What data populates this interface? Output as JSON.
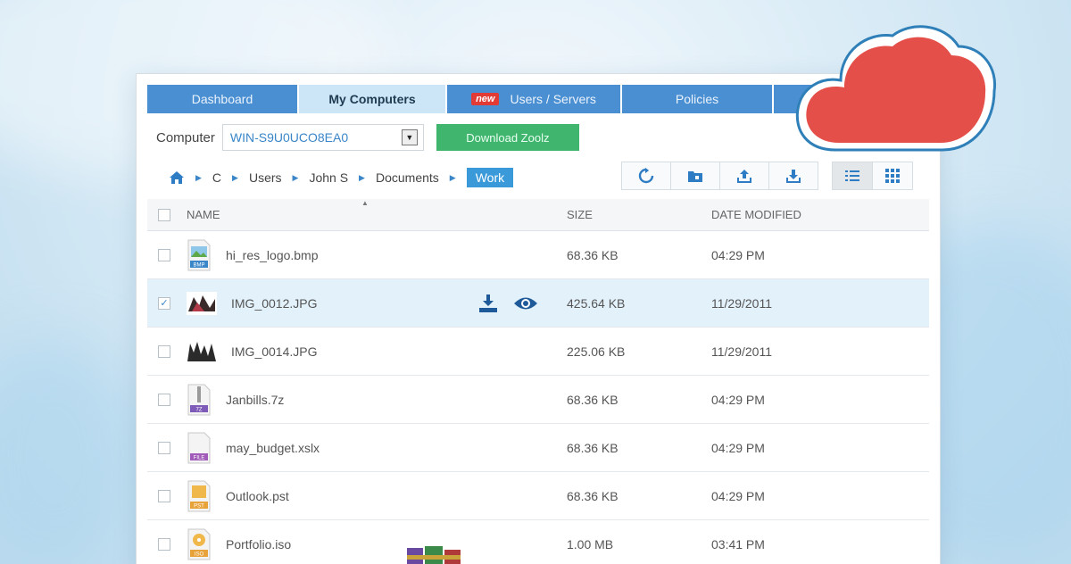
{
  "tabs": [
    {
      "label": "Dashboard",
      "active": false,
      "badge": ""
    },
    {
      "label": "My Computers",
      "active": true,
      "badge": ""
    },
    {
      "label": "Users / Servers",
      "active": false,
      "badge": "new"
    },
    {
      "label": "Policies",
      "active": false,
      "badge": ""
    },
    {
      "label": "",
      "active": false,
      "badge": ""
    }
  ],
  "computer": {
    "label": "Computer",
    "selected": "WIN-S9U0UCO8EA0",
    "download_label": "Download Zoolz"
  },
  "breadcrumb": [
    "C",
    "Users",
    "John S",
    "Documents",
    "Work"
  ],
  "table": {
    "columns": {
      "name": "NAME",
      "size": "SIZE",
      "date": "DATE MODIFIED"
    },
    "rows": [
      {
        "name": "hi_res_logo.bmp",
        "size": "68.36 KB",
        "date": "04:29 PM",
        "icon": "bmp-file-icon",
        "tag": "BMP",
        "selected": false
      },
      {
        "name": "IMG_0012.JPG",
        "size": "425.64 KB",
        "date": "11/29/2011",
        "icon": "photo-thumbnail",
        "tag": "",
        "selected": true
      },
      {
        "name": "IMG_0014.JPG",
        "size": "225.06 KB",
        "date": "11/29/2011",
        "icon": "photo-thumbnail",
        "tag": "",
        "selected": false
      },
      {
        "name": "Janbills.7z",
        "size": "68.36 KB",
        "date": "04:29 PM",
        "icon": "7z-file-icon",
        "tag": "7Z",
        "selected": false
      },
      {
        "name": "may_budget.xslx",
        "size": "68.36 KB",
        "date": "04:29 PM",
        "icon": "generic-file-icon",
        "tag": "FILE",
        "selected": false
      },
      {
        "name": "Outlook.pst",
        "size": "68.36 KB",
        "date": "04:29 PM",
        "icon": "pst-file-icon",
        "tag": "PST",
        "selected": false
      },
      {
        "name": "Portfolio.iso",
        "size": "1.00 MB",
        "date": "03:41 PM",
        "icon": "iso-file-icon",
        "tag": "ISO",
        "selected": false
      }
    ]
  },
  "colors": {
    "tab_blue": "#4b8fd3",
    "tab_active": "#cde6f7",
    "accent": "#3a9ad9",
    "download_green": "#3fb56e",
    "cloud_red": "#e45049",
    "new_badge": "#e23b35"
  }
}
